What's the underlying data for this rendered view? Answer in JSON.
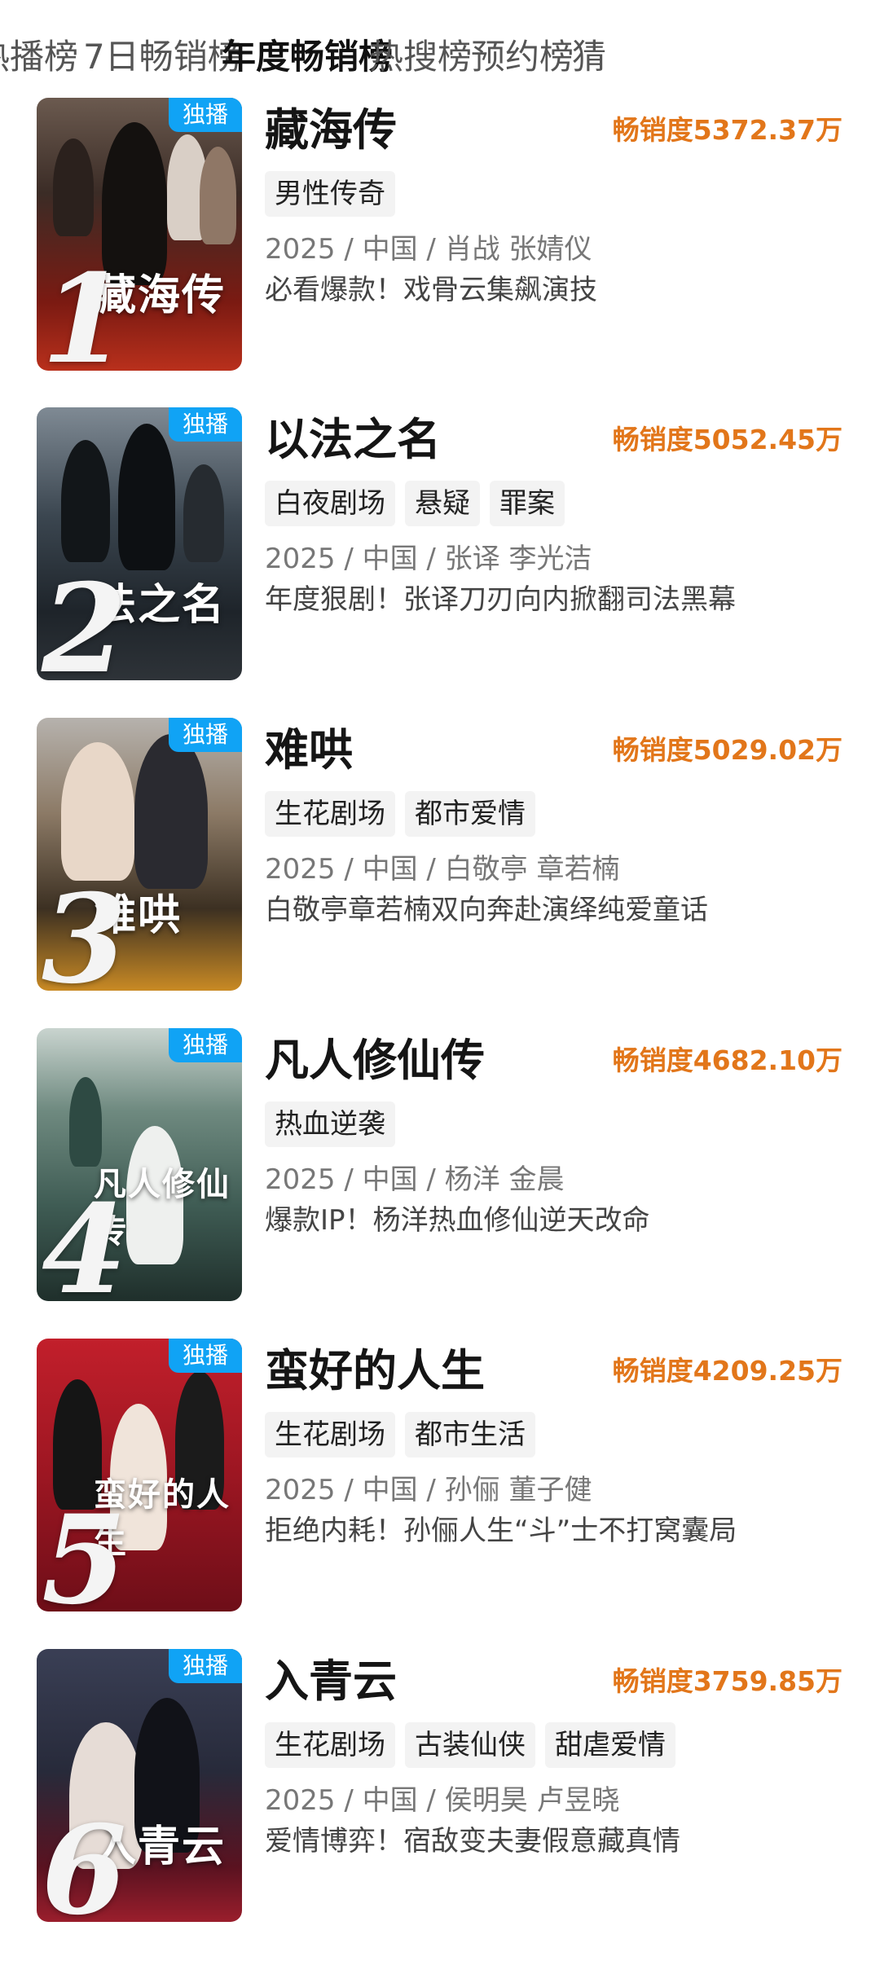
{
  "tabs": [
    {
      "label": "热播榜",
      "active": false
    },
    {
      "label": "7日畅销榜",
      "active": false
    },
    {
      "label": "年度畅销榜",
      "active": true
    },
    {
      "label": "热搜榜",
      "active": false
    },
    {
      "label": "预约榜",
      "active": false
    },
    {
      "label": "猜",
      "active": false
    }
  ],
  "items": [
    {
      "rank": "1",
      "badge": "独播",
      "title": "藏海传",
      "poster_title": "藏海传",
      "score": "畅销度5372.37万",
      "tags": [
        "男性传奇"
      ],
      "meta": "2025 / 中国 / 肖战 张婧仪",
      "desc": "必看爆款！戏骨云集飙演技"
    },
    {
      "rank": "2",
      "badge": "独播",
      "title": "以法之名",
      "poster_title": "法之名",
      "score": "畅销度5052.45万",
      "tags": [
        "白夜剧场",
        "悬疑",
        "罪案"
      ],
      "meta": "2025 / 中国 / 张译 李光洁",
      "desc": "年度狠剧！张译刀刃向内掀翻司法黑幕"
    },
    {
      "rank": "3",
      "badge": "独播",
      "title": "难哄",
      "poster_title": "难哄",
      "score": "畅销度5029.02万",
      "tags": [
        "生花剧场",
        "都市爱情"
      ],
      "meta": "2025 / 中国 / 白敬亭 章若楠",
      "desc": "白敬亭章若楠双向奔赴演绎纯爱童话"
    },
    {
      "rank": "4",
      "badge": "独播",
      "title": "凡人修仙传",
      "poster_title": "凡人修仙传",
      "score": "畅销度4682.10万",
      "tags": [
        "热血逆袭"
      ],
      "meta": "2025 / 中国 / 杨洋 金晨",
      "desc": "爆款IP！杨洋热血修仙逆天改命"
    },
    {
      "rank": "5",
      "badge": "独播",
      "title": "蛮好的人生",
      "poster_title": "蛮好的人生",
      "score": "畅销度4209.25万",
      "tags": [
        "生花剧场",
        "都市生活"
      ],
      "meta": "2025 / 中国 / 孙俪 董子健",
      "desc": "拒绝内耗！孙俪人生“斗”士不打窝囊局"
    },
    {
      "rank": "6",
      "badge": "独播",
      "title": "入青云",
      "poster_title": "入青云",
      "score": "畅销度3759.85万",
      "tags": [
        "生花剧场",
        "古装仙侠",
        "甜虐爱情"
      ],
      "meta": "2025 / 中国 / 侯明昊 卢昱晓",
      "desc": "爱情博弈！宿敌变夫妻假意藏真情"
    }
  ]
}
